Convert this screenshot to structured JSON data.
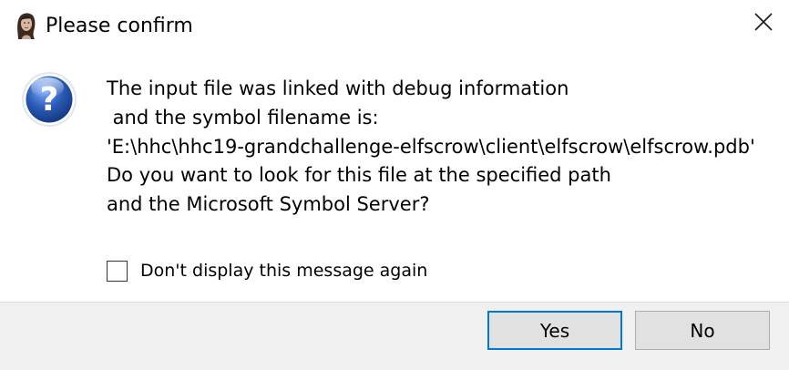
{
  "window": {
    "title": "Please confirm"
  },
  "message": {
    "lines": [
      "The input file was linked with debug information",
      " and the symbol filename is:",
      "'E:\\hhc\\hhc19-grandchallenge-elfscrow\\client\\elfscrow\\elfscrow.pdb'",
      "Do you want to look for this file at the specified path",
      "and the Microsoft Symbol Server?"
    ]
  },
  "checkbox": {
    "label": "Don't display this message again",
    "checked": false
  },
  "buttons": {
    "yes_label": "Yes",
    "no_label": "No"
  },
  "icons": {
    "app": "portrait-app-icon",
    "close": "close-icon",
    "question": "question-icon"
  },
  "colors": {
    "question_blue": "#2a5cb8",
    "footer_bg": "#f0f0f0",
    "default_button_border": "#0078d7",
    "button_bg": "#e1e1e1"
  }
}
